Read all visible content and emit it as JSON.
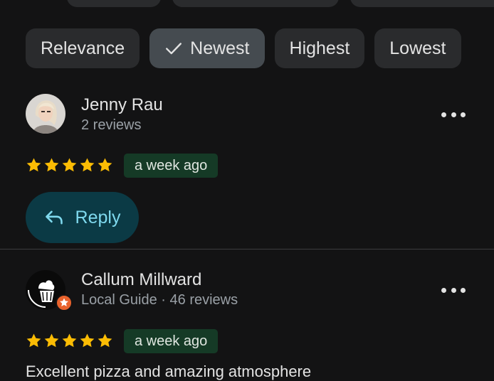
{
  "sort_chips": [
    {
      "label": "Relevance",
      "selected": false
    },
    {
      "label": "Newest",
      "selected": true
    },
    {
      "label": "Highest",
      "selected": false
    },
    {
      "label": "Lowest",
      "selected": false
    }
  ],
  "reviews": [
    {
      "author": "Jenny Rau",
      "meta": "2 reviews",
      "rating": 5,
      "date": "a week ago",
      "reply_label": "Reply"
    },
    {
      "author": "Callum Millward",
      "meta": "Local Guide · 46 reviews",
      "rating": 5,
      "date": "a week ago",
      "text_partial": "Excellent pizza and amazing atmosphere"
    }
  ],
  "colors": {
    "background": "#131314",
    "chip": "#2a2b2d",
    "chip_selected": "#454b50",
    "star": "#fbbc04",
    "date_badge": "#153a26",
    "reply_bg": "#0b3a45",
    "reply_text": "#7fd9ee",
    "local_guide_badge": "#e8622c"
  },
  "icons": [
    "check-icon",
    "more-vert-icon",
    "star-icon",
    "reply-icon",
    "local-guide-badge-icon"
  ]
}
